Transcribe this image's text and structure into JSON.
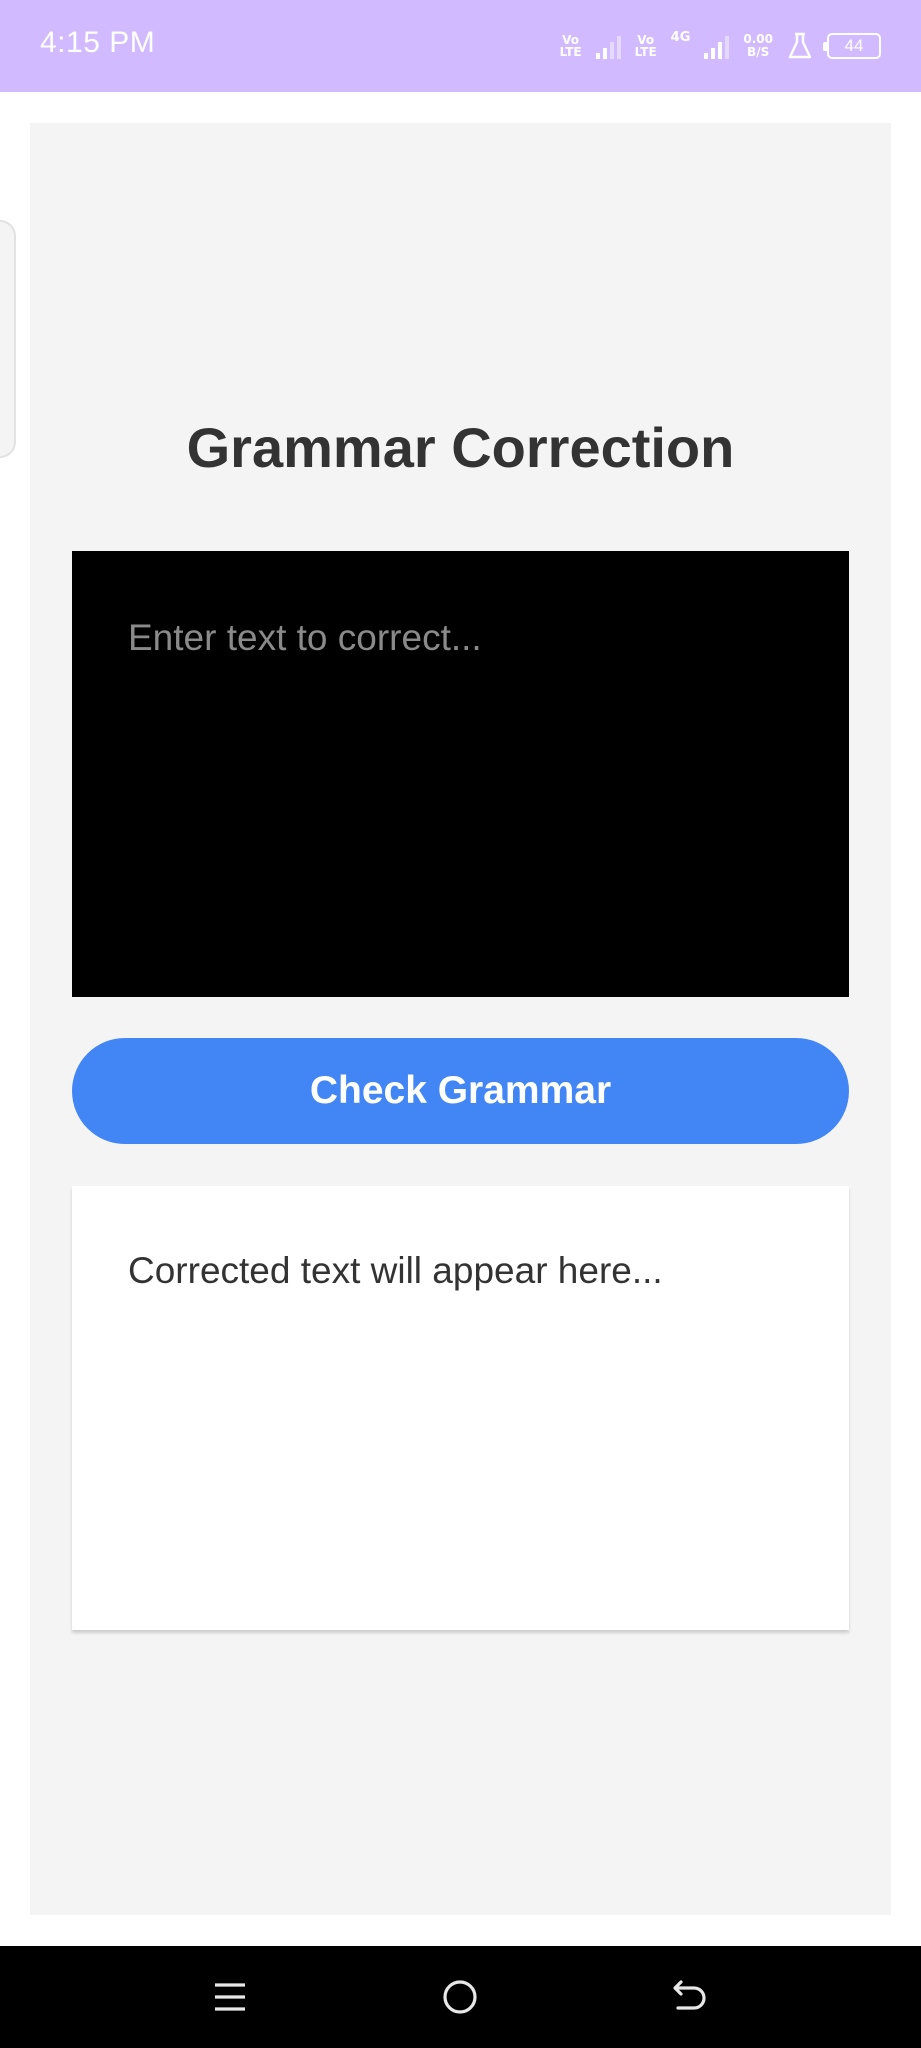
{
  "status_bar": {
    "time": "4:15 PM",
    "sim1_volte": [
      "Vo",
      "LTE"
    ],
    "sim2_volte": [
      "Vo",
      "LTE"
    ],
    "network_type": "4G",
    "speed_value": "0.00",
    "speed_unit": "B/S",
    "battery_level": "44",
    "icons": [
      "volte-icon",
      "signal-icon",
      "signal-4g-icon",
      "flask-icon",
      "battery-icon"
    ],
    "background_color": "#d1baff"
  },
  "app": {
    "title": "Grammar Correction",
    "input": {
      "placeholder": "Enter text to correct...",
      "value": ""
    },
    "check_button_label": "Check Grammar",
    "result_placeholder": "Corrected text will appear here...",
    "accent_color": "#4286f5"
  },
  "nav_bar": {
    "icons": [
      "menu-icon",
      "home-icon",
      "back-icon"
    ]
  }
}
